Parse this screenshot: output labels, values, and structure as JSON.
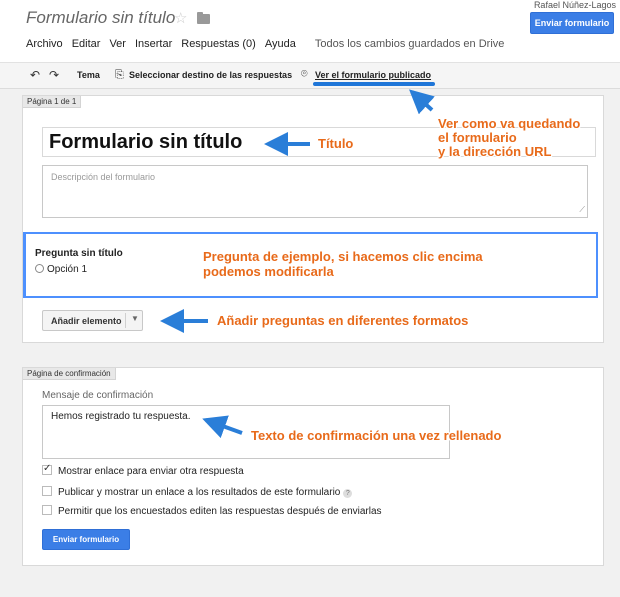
{
  "header": {
    "doc_title": "Formulario sin título",
    "star_icon": "star-icon",
    "folder_icon": "folder-icon",
    "user_name": "Rafael Núñez-Lagos",
    "send_button": "Enviar formulario"
  },
  "menu": {
    "items": [
      "Archivo",
      "Editar",
      "Ver",
      "Insertar",
      "Respuestas (0)",
      "Ayuda"
    ],
    "saved_status": "Todos los cambios guardados en Drive"
  },
  "toolbar": {
    "undo_icon": "undo-icon",
    "redo_icon": "redo-icon",
    "theme": "Tema",
    "destination": "Seleccionar destino de las respuestas",
    "view_published": "Ver el formulario publicado"
  },
  "form_page": {
    "tab": "Página 1 de 1",
    "title": "Formulario sin título",
    "description_placeholder": "Descripción del formulario",
    "question": {
      "title": "Pregunta sin título",
      "option": "Opción 1"
    },
    "add_item": "Añadir elemento"
  },
  "confirmation": {
    "tab": "Página de confirmación",
    "label": "Mensaje de confirmación",
    "message": "Hemos registrado tu respuesta.",
    "options": [
      {
        "label": "Mostrar enlace para enviar otra respuesta",
        "checked": true
      },
      {
        "label": "Publicar y mostrar un enlace a los resultados de este formulario",
        "checked": false,
        "help": "?"
      },
      {
        "label": "Permitir que los encuestados editen las respuestas después de enviarlas",
        "checked": false
      }
    ],
    "send_button": "Enviar formulario"
  },
  "annotations": {
    "view_line1": "Ver como va quedando",
    "view_line2": "el formulario",
    "view_line3": "y la dirección URL",
    "title": "Título",
    "question_line1": "Pregunta de ejemplo, si hacemos clic encima",
    "question_line2": "podemos modificarla",
    "add": "Añadir preguntas en diferentes formatos",
    "confirm": "Texto de confirmación una vez rellenado",
    "color": "#e86a1a",
    "arrow_color": "#2a7ed8"
  },
  "colors": {
    "accent": "#3b7ee6",
    "focus_border": "#4d90fe"
  }
}
